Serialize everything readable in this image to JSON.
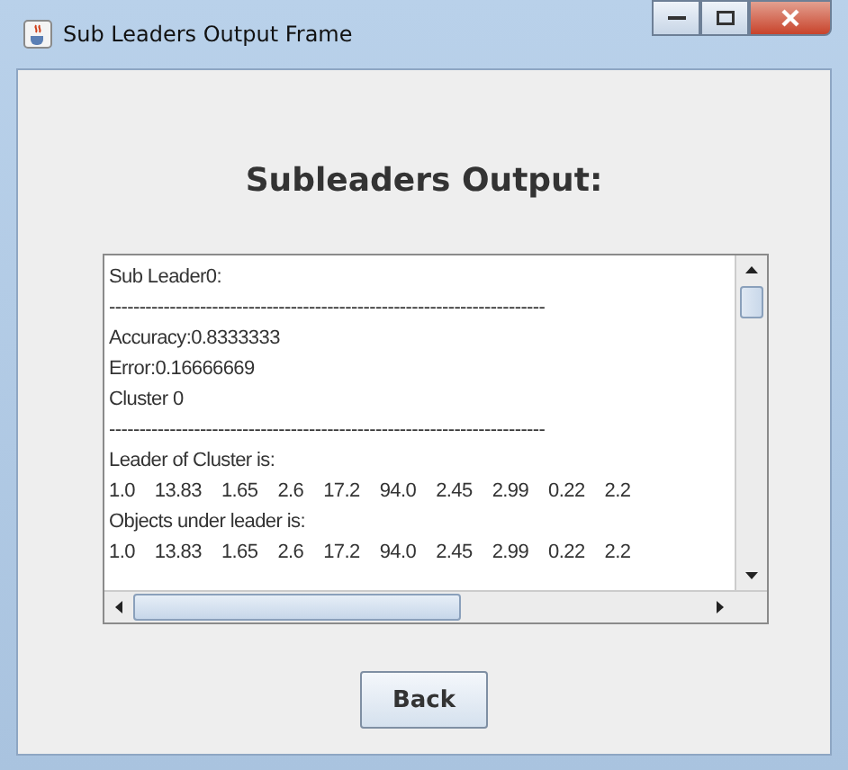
{
  "window": {
    "title": "Sub Leaders Output Frame"
  },
  "heading": "Subleaders Output:",
  "output_lines": [
    "Sub Leader0:",
    "------------------------------------------------------------------------",
    "Accuracy:0.8333333",
    "Error:0.16666669",
    "Cluster 0",
    "------------------------------------------------------------------------",
    "Leader of Cluster is:",
    "1.0    13.83    1.65    2.6    17.2    94.0    2.45    2.99    0.22    2.2",
    "Objects under leader is:",
    "1.0    13.83    1.65    2.6    17.2    94.0    2.45    2.99    0.22    2.2"
  ],
  "buttons": [
    "Back"
  ]
}
